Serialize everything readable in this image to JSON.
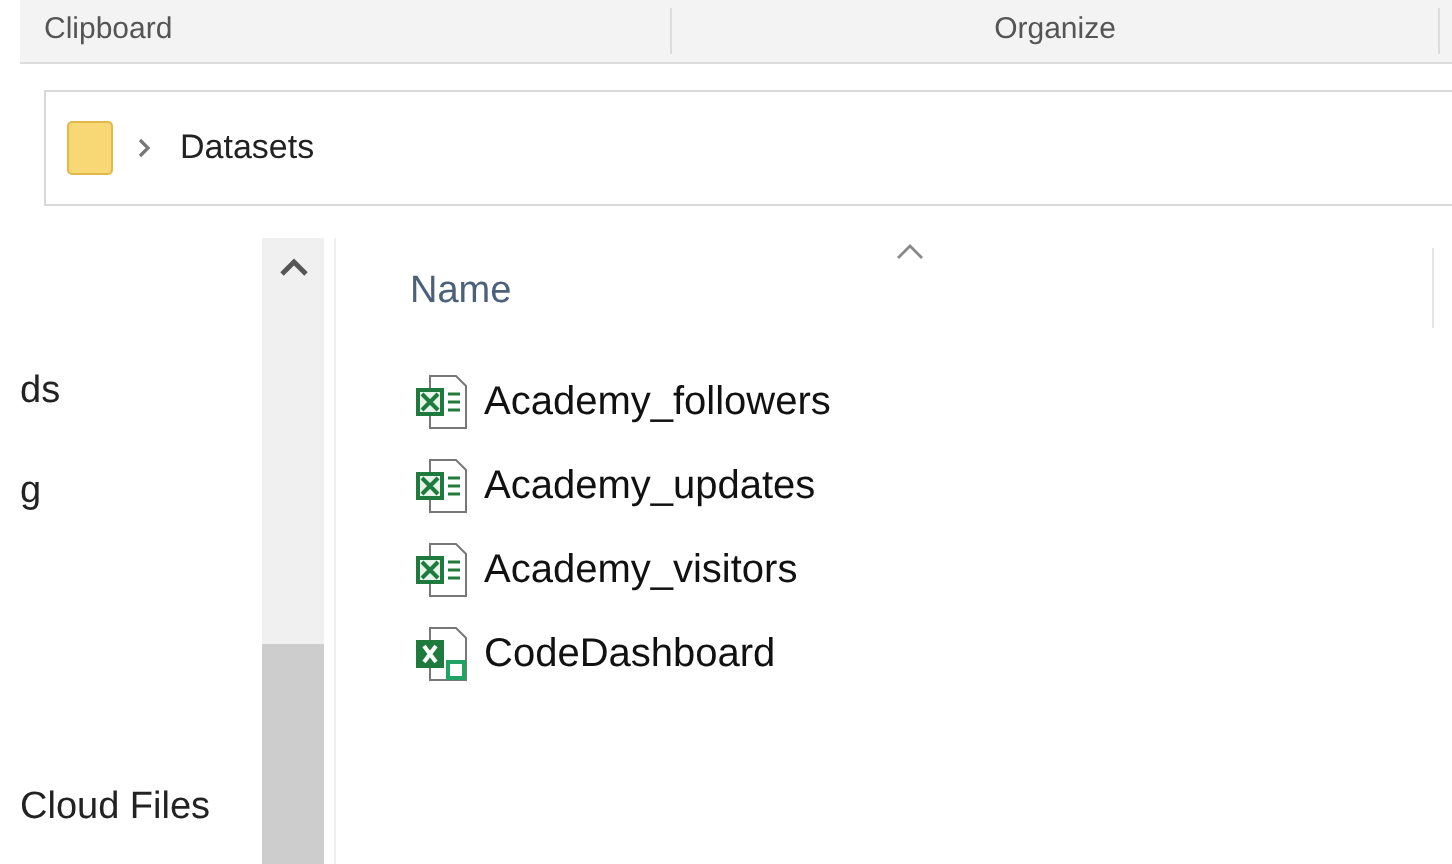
{
  "ribbon": {
    "groups": [
      "Clipboard",
      "Organize"
    ]
  },
  "address_bar": {
    "path": [
      "Datasets"
    ]
  },
  "nav_pane": {
    "items": [
      "ds",
      "g",
      "Cloud Files"
    ]
  },
  "file_list": {
    "columns": [
      "Name"
    ],
    "files": [
      {
        "name": "Academy_followers",
        "kind": "csv"
      },
      {
        "name": "Academy_updates",
        "kind": "csv"
      },
      {
        "name": "Academy_visitors",
        "kind": "csv"
      },
      {
        "name": "CodeDashboard",
        "kind": "xlsx"
      }
    ]
  }
}
